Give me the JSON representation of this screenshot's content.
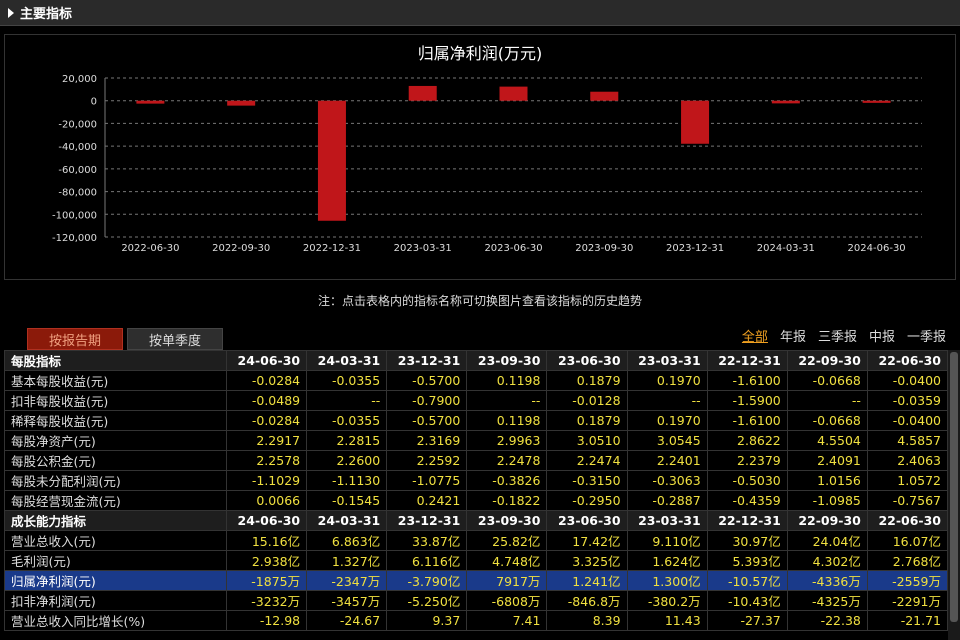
{
  "section": {
    "title": "主要指标"
  },
  "chart_data": {
    "type": "bar",
    "title": "归属净利润(万元)",
    "categories": [
      "2022-06-30",
      "2022-09-30",
      "2022-12-31",
      "2023-03-31",
      "2023-06-30",
      "2023-09-30",
      "2023-12-31",
      "2024-03-31",
      "2024-06-30"
    ],
    "values": [
      -2559,
      -4325,
      -105700,
      13000,
      12410,
      7917,
      -37900,
      -2347,
      -1875
    ],
    "ylim": [
      -120000,
      20000
    ],
    "yticks": [
      20000,
      0,
      -20000,
      -40000,
      -60000,
      -80000,
      -100000,
      -120000
    ],
    "ytick_labels": [
      "20,000",
      "0",
      "-20,000",
      "-40,000",
      "-60,000",
      "-80,000",
      "-100,000",
      "-120,000"
    ],
    "grid": true,
    "bar_color": "#c0161a"
  },
  "note": "注：点击表格内的指标名称可切换图片查看该指标的历史趋势",
  "tabs": {
    "report": "按报告期",
    "quarter": "按单季度"
  },
  "filters": [
    "全部",
    "年报",
    "三季报",
    "中报",
    "一季报"
  ],
  "table": {
    "rows": [
      {
        "type": "header",
        "label": "每股指标",
        "cells": [
          "24-06-30",
          "24-03-31",
          "23-12-31",
          "23-09-30",
          "23-06-30",
          "23-03-31",
          "22-12-31",
          "22-09-30",
          "22-06-30"
        ]
      },
      {
        "type": "data",
        "label": "基本每股收益(元)",
        "cells": [
          "-0.0284",
          "-0.0355",
          "-0.5700",
          "0.1198",
          "0.1879",
          "0.1970",
          "-1.6100",
          "-0.0668",
          "-0.0400"
        ]
      },
      {
        "type": "data",
        "label": "扣非每股收益(元)",
        "cells": [
          "-0.0489",
          "--",
          "-0.7900",
          "--",
          "-0.0128",
          "--",
          "-1.5900",
          "--",
          "-0.0359"
        ]
      },
      {
        "type": "data",
        "label": "稀释每股收益(元)",
        "cells": [
          "-0.0284",
          "-0.0355",
          "-0.5700",
          "0.1198",
          "0.1879",
          "0.1970",
          "-1.6100",
          "-0.0668",
          "-0.0400"
        ]
      },
      {
        "type": "data",
        "label": "每股净资产(元)",
        "cells": [
          "2.2917",
          "2.2815",
          "2.3169",
          "2.9963",
          "3.0510",
          "3.0545",
          "2.8622",
          "4.5504",
          "4.5857"
        ]
      },
      {
        "type": "data",
        "label": "每股公积金(元)",
        "cells": [
          "2.2578",
          "2.2600",
          "2.2592",
          "2.2478",
          "2.2474",
          "2.2401",
          "2.2379",
          "2.4091",
          "2.4063"
        ]
      },
      {
        "type": "data",
        "label": "每股未分配利润(元)",
        "cells": [
          "-1.1029",
          "-1.1130",
          "-1.0775",
          "-0.3826",
          "-0.3150",
          "-0.3063",
          "-0.5030",
          "1.0156",
          "1.0572"
        ]
      },
      {
        "type": "data",
        "label": "每股经营现金流(元)",
        "cells": [
          "0.0066",
          "-0.1545",
          "0.2421",
          "-0.1822",
          "-0.2950",
          "-0.2887",
          "-0.4359",
          "-1.0985",
          "-0.7567"
        ]
      },
      {
        "type": "header",
        "label": "成长能力指标",
        "cells": [
          "24-06-30",
          "24-03-31",
          "23-12-31",
          "23-09-30",
          "23-06-30",
          "23-03-31",
          "22-12-31",
          "22-09-30",
          "22-06-30"
        ]
      },
      {
        "type": "data",
        "label": "营业总收入(元)",
        "cells": [
          "15.16亿",
          "6.863亿",
          "33.87亿",
          "25.82亿",
          "17.42亿",
          "9.110亿",
          "30.97亿",
          "24.04亿",
          "16.07亿"
        ]
      },
      {
        "type": "data",
        "label": "毛利润(元)",
        "cells": [
          "2.938亿",
          "1.327亿",
          "6.116亿",
          "4.748亿",
          "3.325亿",
          "1.624亿",
          "5.393亿",
          "4.302亿",
          "2.768亿"
        ]
      },
      {
        "type": "highlight",
        "label": "归属净利润(元)",
        "cells": [
          "-1875万",
          "-2347万",
          "-3.790亿",
          "7917万",
          "1.241亿",
          "1.300亿",
          "-10.57亿",
          "-4336万",
          "-2559万"
        ]
      },
      {
        "type": "data",
        "label": "扣非净利润(元)",
        "cells": [
          "-3232万",
          "-3457万",
          "-5.250亿",
          "-6808万",
          "-846.8万",
          "-380.2万",
          "-10.43亿",
          "-4325万",
          "-2291万"
        ]
      },
      {
        "type": "data",
        "label": "营业总收入同比增长(%)",
        "cells": [
          "-12.98",
          "-24.67",
          "9.37",
          "7.41",
          "8.39",
          "11.43",
          "-27.37",
          "-22.38",
          "-21.71"
        ]
      }
    ]
  }
}
